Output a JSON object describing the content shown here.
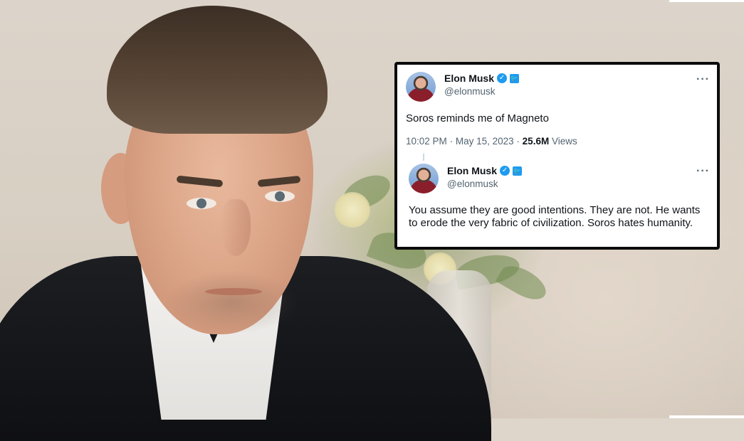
{
  "tweet_main": {
    "display_name": "Elon Musk",
    "verified_icon": "verified-check-icon",
    "affiliation_icon": "twitter-bird-icon",
    "handle": "@elonmusk",
    "text": "Soros reminds me of Magneto",
    "time": "10:02 PM",
    "separator": "·",
    "date": "May 15, 2023",
    "views_count": "25.6M",
    "views_label": "Views",
    "more_label": "···"
  },
  "tweet_reply": {
    "display_name": "Elon Musk",
    "verified_icon": "verified-check-icon",
    "affiliation_icon": "twitter-bird-icon",
    "handle": "@elonmusk",
    "text": "You assume they are good intentions. They are not. He wants to erode the very fabric of civilization. Soros hates humanity.",
    "more_label": "···"
  },
  "colors": {
    "twitter_blue": "#1d9bf0",
    "text_primary": "#0f1419",
    "text_secondary": "#536471",
    "card_border": "#0b0b0b"
  }
}
